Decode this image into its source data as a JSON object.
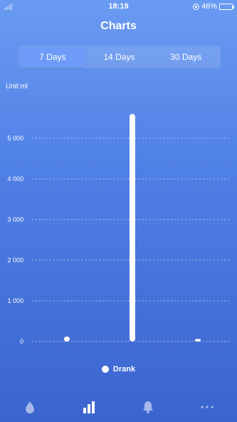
{
  "status_bar": {
    "time": "18:19",
    "battery": "46%",
    "battery_level": 0.46
  },
  "header": {
    "title": "Charts"
  },
  "tabs": [
    {
      "label": "7 Days",
      "active": true
    },
    {
      "label": "14 Days",
      "active": false
    },
    {
      "label": "30 Days",
      "active": false
    }
  ],
  "chart": {
    "unit_label": "Unit:ml"
  },
  "legend": {
    "label": "Drank"
  },
  "colors": {
    "accent_active": "#6d9bf7",
    "battery": "#f5c842"
  },
  "bottom_nav": [
    {
      "icon": "drop-icon"
    },
    {
      "icon": "bar-chart-icon"
    },
    {
      "icon": "bell-icon"
    },
    {
      "icon": "more-icon"
    }
  ],
  "chart_data": {
    "type": "bar",
    "title": "",
    "xlabel": "",
    "ylabel": "Unit:ml",
    "ylim": [
      0,
      5700
    ],
    "yticks": [
      0,
      1000,
      2000,
      3000,
      4000,
      5000
    ],
    "ytick_labels": [
      "0",
      "1 000",
      "2 000",
      "3 000",
      "4 000",
      "5 000"
    ],
    "series": [
      {
        "name": "Drank",
        "values": [
          120,
          5600,
          60
        ]
      }
    ],
    "grid": true,
    "legend_position": "bottom"
  }
}
